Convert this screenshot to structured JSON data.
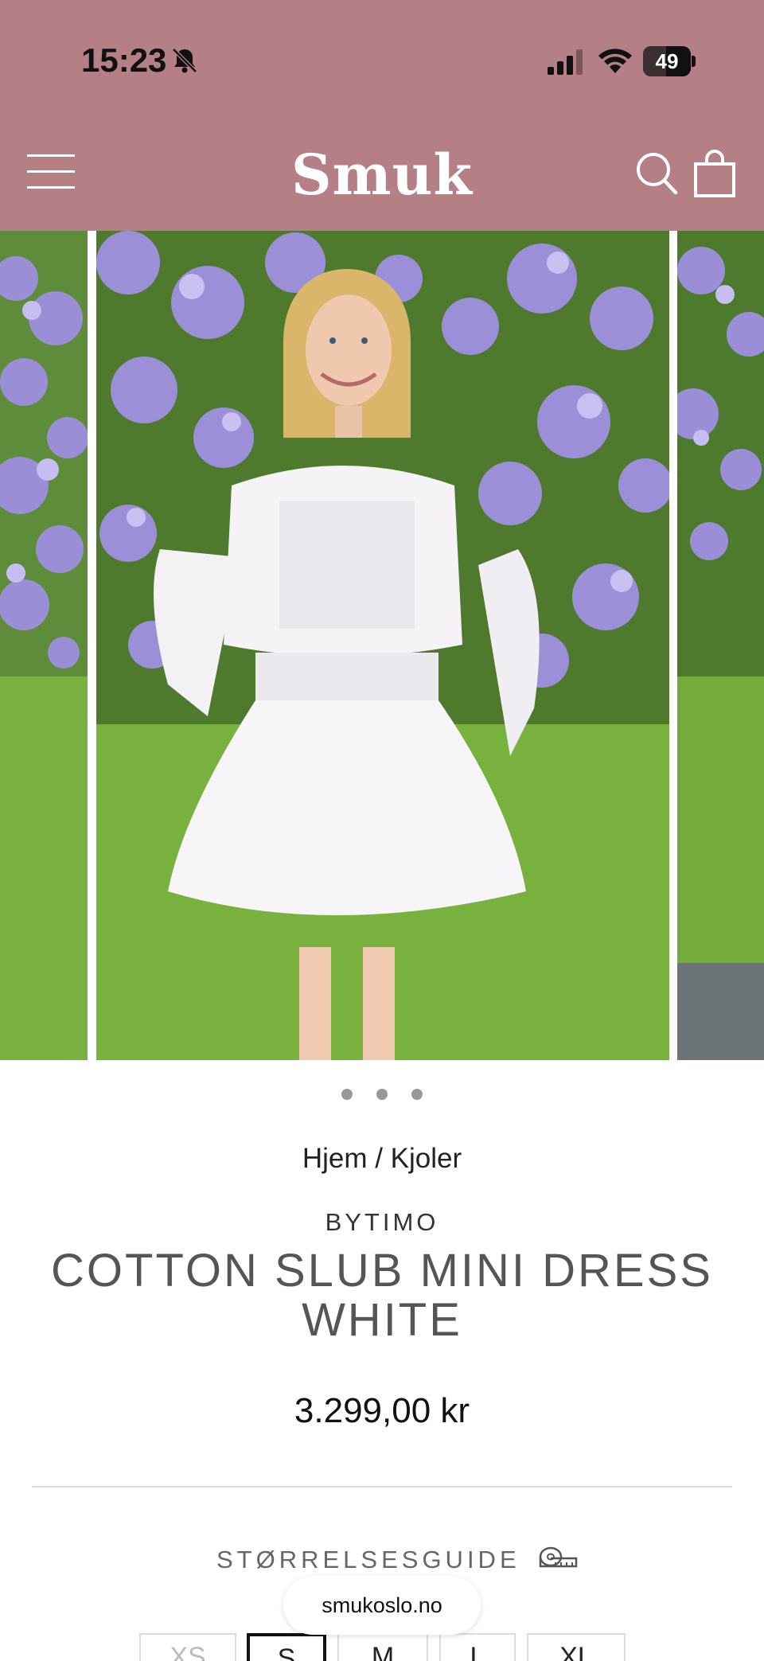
{
  "status_bar": {
    "time": "15:23",
    "battery": "49",
    "battery_level": 0.49
  },
  "header": {
    "logo": "Smuk",
    "background_color": "#b57f86"
  },
  "gallery": {
    "slide_count": 3,
    "active_slide": 1
  },
  "product": {
    "breadcrumb": "Hjem / Kjoler",
    "brand": "BYTIMO",
    "title": "COTTON SLUB MINI DRESS WHITE",
    "price": "3.299,00 kr"
  },
  "size_guide": {
    "label": "STØRRELSESGUIDE"
  },
  "sizes": [
    {
      "label": "XS",
      "state": "unavailable"
    },
    {
      "label": "S",
      "state": "selected"
    },
    {
      "label": "M",
      "state": "available"
    },
    {
      "label": "L",
      "state": "available"
    },
    {
      "label": "XL",
      "state": "available"
    }
  ],
  "url_pill": {
    "domain": "smukoslo.no"
  },
  "icons": [
    "bell-slash-icon",
    "signal-icon",
    "wifi-icon",
    "battery-icon",
    "hamburger-menu-icon",
    "search-icon",
    "shopping-bag-icon",
    "zoom-icon",
    "measuring-tape-icon"
  ]
}
